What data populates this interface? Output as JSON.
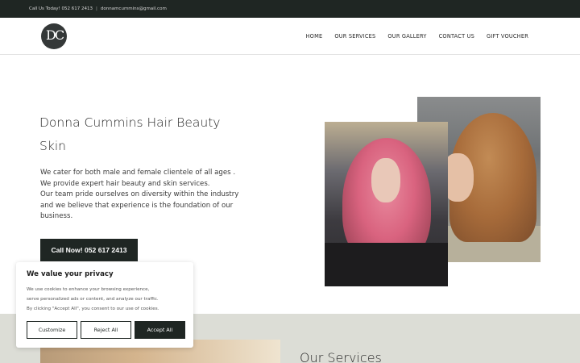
{
  "topbar": {
    "call_text": "Call Us Today! 052 617 2413",
    "separator": "|",
    "email": "donnamcummins@gmail.com"
  },
  "header": {
    "logo_icon": "dc-monogram-logo",
    "nav": [
      {
        "label": "HOME"
      },
      {
        "label": "OUR SERVICES"
      },
      {
        "label": "OUR GALLERY"
      },
      {
        "label": "CONTACT US"
      },
      {
        "label": "GIFT VOUCHER"
      }
    ]
  },
  "hero": {
    "title_line1": "Donna Cummins Hair Beauty",
    "title_line2": "Skin",
    "paragraph_lines": [
      "We cater for both male and female clientele of all ages .",
      "We provide expert hair beauty and skin services.",
      "Our team pride ourselves on diversity within the industry",
      "and we believe that experience is the foundation of our",
      "business."
    ],
    "cta_label": "Call Now! 052 617 2413"
  },
  "services": {
    "title": "Our Services"
  },
  "cookie": {
    "title": "We value your privacy",
    "text_lines": [
      "We use cookies to enhance your browsing experience,",
      "serve personalized ads or content, and analyze our traffic.",
      "By clicking \"Accept All\", you consent to our use of cookies."
    ],
    "customize_label": "Customize",
    "reject_label": "Reject All",
    "accept_label": "Accept All"
  },
  "colors": {
    "dark": "#1f2623",
    "band": "#dcddd6"
  }
}
